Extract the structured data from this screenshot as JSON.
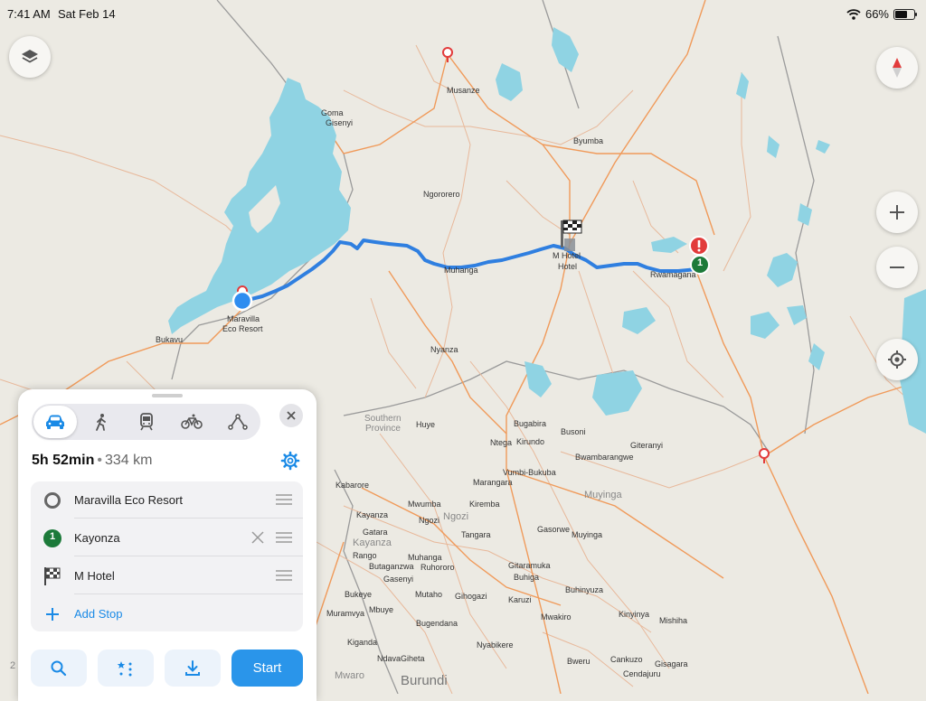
{
  "status_bar": {
    "time": "7:41 AM",
    "date": "Sat Feb 14",
    "battery": "66%",
    "battery_level": 0.66
  },
  "colors": {
    "route": "#2f7fe0",
    "water": "#8fd3e3",
    "accent": "#1a8ae6",
    "waypoint_green": "#1c7a3a",
    "alert_red": "#e23b3b",
    "start_button": "#2a95ea"
  },
  "map": {
    "labels": {
      "goma": "Goma",
      "gisenyi": "Gisenyi",
      "musanze": "Musanze",
      "byumba": "Byumba",
      "ngororero": "Ngororero",
      "muhanga": "Muhanga",
      "m_hotel_1": "M Hotel",
      "m_hotel_2": "Hotel",
      "rwamagana": "Rwamagana",
      "maravilla_1": "Maravilla",
      "maravilla_2": "Eco Resort",
      "bukavu": "Bukavu",
      "nyanza": "Nyanza",
      "southern_1": "Southern",
      "southern_2": "Province",
      "huye": "Huye",
      "bugabira": "Bugabira",
      "busoni": "Busoni",
      "ntega": "Ntega",
      "kirundo": "Kirundo",
      "bwambarangwe": "Bwambarangwe",
      "giteranyi": "Giteranyi",
      "vumbi": "Vumbi-Bukuba",
      "marangara": "Marangara",
      "kabarore": "Kabarore",
      "muyinga_region": "Muyinga",
      "mwumba": "Mwumba",
      "kiremba": "Kiremba",
      "kayanza": "Kayanza",
      "ngozi": "Ngozi",
      "ngozi_region": "Ngozi",
      "gatara": "Gatara",
      "tangara": "Tangara",
      "gasorwe": "Gasorwe",
      "muyinga": "Muyinga",
      "kayanza_region": "Kayanza",
      "muhanga_bi": "Muhanga",
      "rango": "Rango",
      "ruhororo": "Ruhororo",
      "butaganzwa": "Butaganzwa",
      "gisagara": "Gitaramuka",
      "gasenyi": "Gasenyi",
      "buhiga": "Buhiga",
      "bukeye": "Bukeye",
      "mutaho": "Mutaho",
      "gihogazi": "Gihogazi",
      "karuzi": "Karuzi",
      "buhinyuza": "Buhinyuza",
      "muramvya": "Muramvya",
      "mbuye": "Mbuye",
      "bugendana": "Bugendana",
      "mwakiro": "Mwakiro",
      "kinyinya": "Kinyinya",
      "mishiha": "Mishiha",
      "kiganda": "Kiganda",
      "nyabikere": "Nyabikere",
      "ndava": "Ndava",
      "giheta": "Giheta",
      "bweru": "Bweru",
      "cankuzo": "Cankuzo",
      "cendajuru": "Cendajuru",
      "gisagara2": "Gisagara",
      "mwaro": "Mwaro",
      "burundi": "Burundi",
      "scale_fragment": "2"
    },
    "waypoint_number": "1"
  },
  "controls": {
    "layers": "layers-icon",
    "compass": "compass-icon",
    "zoom_in": "plus-icon",
    "zoom_out": "minus-icon",
    "locate": "locate-icon"
  },
  "route_panel": {
    "modes": [
      "car",
      "walk",
      "transit",
      "bike",
      "custom"
    ],
    "active_mode": "car",
    "duration": "5h 52min",
    "separator": "•",
    "distance": "334 km",
    "stops": [
      {
        "name": "Maravilla Eco Resort",
        "icon": "origin-circle-icon"
      },
      {
        "name": "Kayonza",
        "icon": "waypoint-1-icon",
        "number": "1"
      },
      {
        "name": "M Hotel",
        "icon": "checkered-flag-icon"
      }
    ],
    "add_stop": "Add Stop",
    "buttons": {
      "start": "Start"
    }
  }
}
